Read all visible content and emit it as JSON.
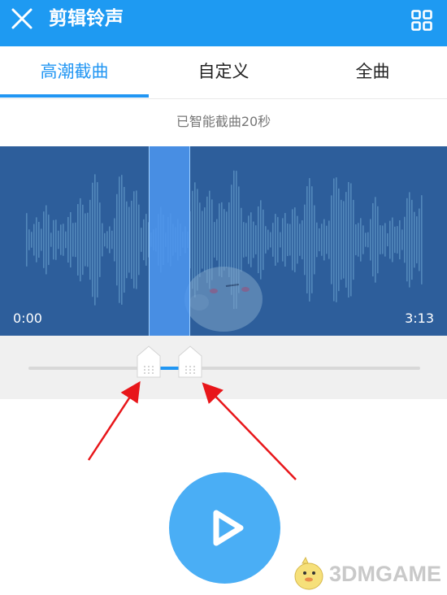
{
  "header": {
    "title": "剪辑铃声",
    "close_icon": "close-icon",
    "grid_icon": "grid-icon",
    "background_color": "#1e9af2"
  },
  "tabs": [
    {
      "label": "高潮截曲",
      "active": true
    },
    {
      "label": "自定义",
      "active": false
    },
    {
      "label": "全曲",
      "active": false
    }
  ],
  "status_text": "已智能截曲20秒",
  "waveform": {
    "start_time": "0:00",
    "end_time": "3:13",
    "background_color": "#2d5e9b",
    "selection_color": "#4e96f0"
  },
  "slider": {
    "accent_color": "#2196f3"
  },
  "player": {
    "play_icon": "play-icon",
    "button_color": "#4aaef5"
  },
  "watermark": {
    "text": "3DMGAME"
  },
  "annotations": {
    "arrow_color": "#e8161a"
  }
}
